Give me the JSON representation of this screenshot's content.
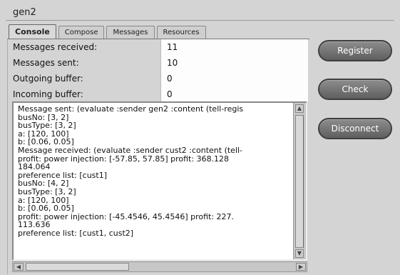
{
  "window": {
    "title": "gen2"
  },
  "tabs": [
    {
      "label": "Console",
      "active": true
    },
    {
      "label": "Compose",
      "active": false
    },
    {
      "label": "Messages",
      "active": false
    },
    {
      "label": "Resources",
      "active": false
    }
  ],
  "stats": [
    {
      "label": "Messages received:",
      "value": "11"
    },
    {
      "label": "Messages sent:",
      "value": "10"
    },
    {
      "label": "Outgoing buffer:",
      "value": "0"
    },
    {
      "label": "Incoming buffer:",
      "value": "0"
    }
  ],
  "console": {
    "lines": [
      "Message sent: (evaluate :sender gen2 :content (tell-regis",
      "busNo: [3, 2]",
      "busType: [3, 2]",
      "a: [120, 100]",
      "b: [0.06, 0.05]",
      "Message received: (evaluate :sender cust2 :content (tell-",
      "profit: power injection: [-57.85, 57.85] profit: 368.128",
      "184.064",
      "preference list: [cust1]",
      "busNo: [4, 2]",
      "busType: [3, 2]",
      "a: [120, 100]",
      "b: [0.06, 0.05]",
      "profit: power injection: [-45.4546, 45.4546] profit: 227.",
      "113.636",
      "preference list: [cust1, cust2]"
    ]
  },
  "buttons": {
    "register": "Register",
    "check": "Check",
    "disconnect": "Disconnect"
  }
}
